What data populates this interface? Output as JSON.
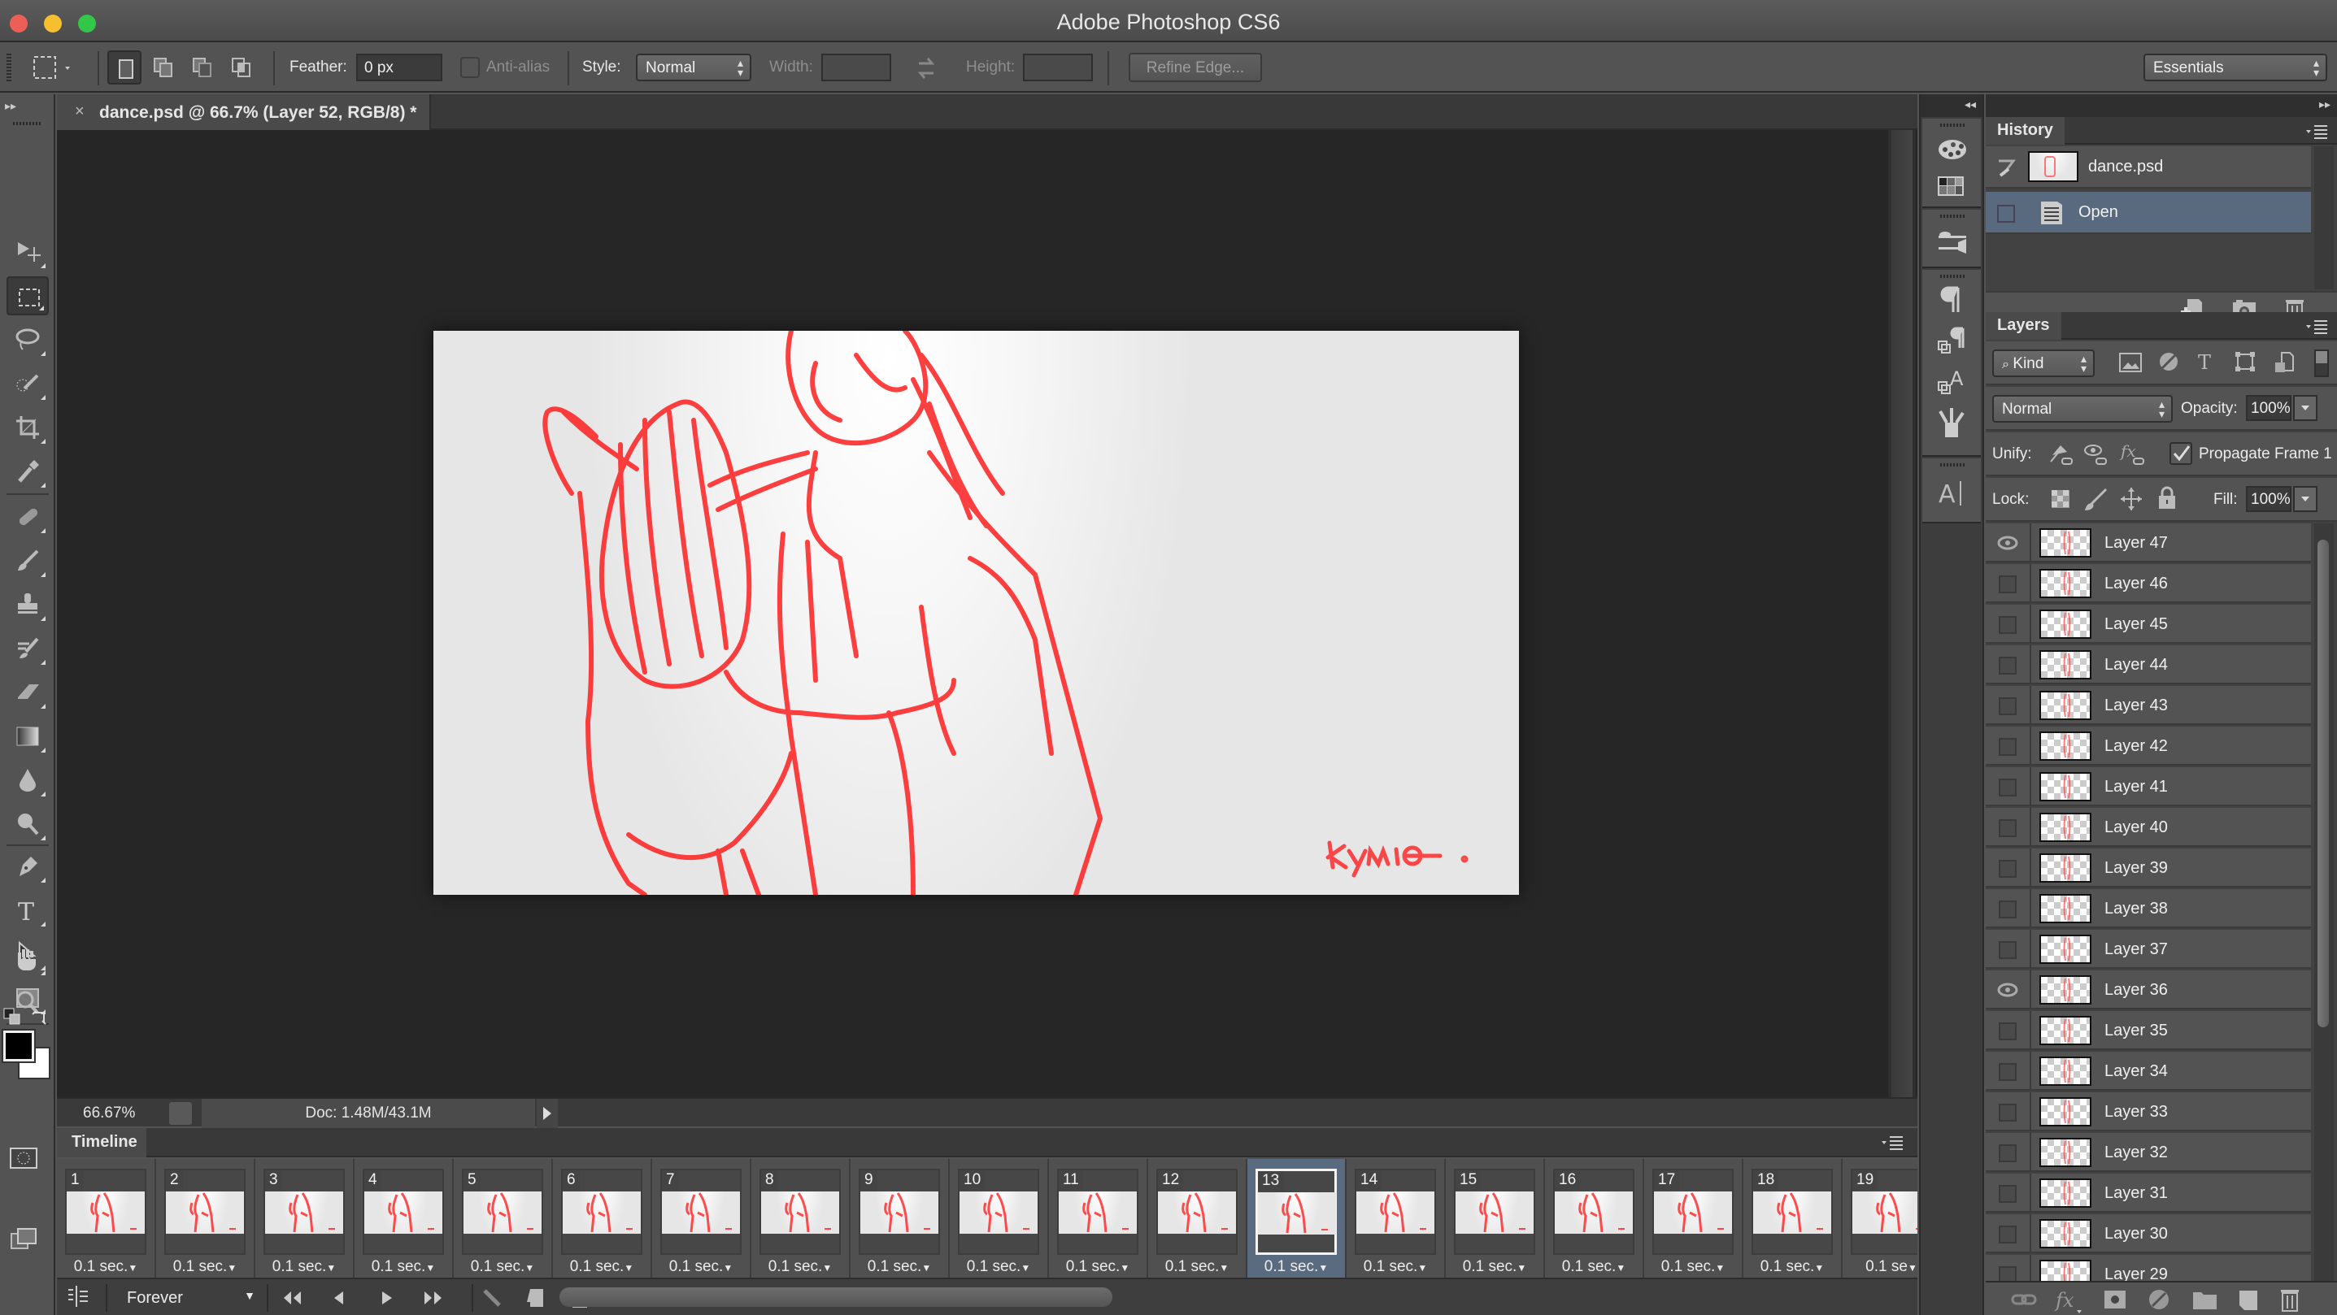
{
  "window": {
    "title": "Adobe Photoshop CS6",
    "traffic_colors": {
      "close": "#ec5f57",
      "minimize": "#f5bf2f",
      "zoom": "#32c748"
    }
  },
  "options_bar": {
    "feather_label": "Feather:",
    "feather_value": "0 px",
    "antialias_label": "Anti-alias",
    "style_label": "Style:",
    "style_value": "Normal",
    "width_label": "Width:",
    "width_value": "",
    "height_label": "Height:",
    "height_value": "",
    "refine_edge_label": "Refine Edge...",
    "workspace_value": "Essentials"
  },
  "tools": [
    {
      "name": "move-tool",
      "icon": "move-icon"
    },
    {
      "name": "rectangular-marquee-tool",
      "icon": "marquee-icon",
      "active": true
    },
    {
      "name": "lasso-tool",
      "icon": "lasso-icon"
    },
    {
      "name": "quick-selection-tool",
      "icon": "quick-selection-icon"
    },
    {
      "name": "crop-tool",
      "icon": "crop-icon"
    },
    {
      "name": "eyedropper-tool",
      "icon": "eyedropper-icon"
    },
    {
      "name": "spot-healing-tool",
      "icon": "bandage-icon"
    },
    {
      "name": "brush-tool",
      "icon": "brush-icon"
    },
    {
      "name": "clone-stamp-tool",
      "icon": "stamp-icon"
    },
    {
      "name": "history-brush-tool",
      "icon": "history-brush-icon"
    },
    {
      "name": "eraser-tool",
      "icon": "eraser-icon"
    },
    {
      "name": "gradient-tool",
      "icon": "gradient-icon"
    },
    {
      "name": "blur-tool",
      "icon": "drop-icon"
    },
    {
      "name": "dodge-tool",
      "icon": "dodge-icon"
    },
    {
      "name": "pen-tool",
      "icon": "pen-icon"
    },
    {
      "name": "type-tool",
      "icon": "type-icon"
    },
    {
      "name": "path-selection-tool",
      "icon": "arrow-icon"
    },
    {
      "name": "rectangle-tool",
      "icon": "rectangle-icon"
    },
    {
      "name": "hand-tool",
      "icon": "hand-icon"
    },
    {
      "name": "zoom-tool",
      "icon": "magnifier-icon"
    }
  ],
  "colors": {
    "foreground": "#000000",
    "background": "#ffffff"
  },
  "document": {
    "tab_title": "dance.psd @ 66.7% (Layer 52, RGB/8) *",
    "signature": "kymio .",
    "stroke_color": "#ff1a1a"
  },
  "status": {
    "zoom": "66.67%",
    "doc_size": "Doc: 1.48M/43.1M"
  },
  "timeline": {
    "title": "Timeline",
    "loop": "Forever",
    "selected_frame": 13,
    "frames": [
      {
        "n": "1",
        "d": "0.1 sec."
      },
      {
        "n": "2",
        "d": "0.1 sec."
      },
      {
        "n": "3",
        "d": "0.1 sec."
      },
      {
        "n": "4",
        "d": "0.1 sec."
      },
      {
        "n": "5",
        "d": "0.1 sec."
      },
      {
        "n": "6",
        "d": "0.1 sec."
      },
      {
        "n": "7",
        "d": "0.1 sec."
      },
      {
        "n": "8",
        "d": "0.1 sec."
      },
      {
        "n": "9",
        "d": "0.1 sec."
      },
      {
        "n": "10",
        "d": "0.1 sec."
      },
      {
        "n": "11",
        "d": "0.1 sec."
      },
      {
        "n": "12",
        "d": "0.1 sec."
      },
      {
        "n": "13",
        "d": "0.1 sec."
      },
      {
        "n": "14",
        "d": "0.1 sec."
      },
      {
        "n": "15",
        "d": "0.1 sec."
      },
      {
        "n": "16",
        "d": "0.1 sec."
      },
      {
        "n": "17",
        "d": "0.1 sec."
      },
      {
        "n": "18",
        "d": "0.1 sec."
      },
      {
        "n": "19",
        "d": "0.1 se"
      }
    ]
  },
  "history": {
    "title": "History",
    "snapshot": "dance.psd",
    "items": [
      "Open"
    ]
  },
  "layers": {
    "title": "Layers",
    "filter_kind": "Kind",
    "blend_mode": "Normal",
    "opacity_label": "Opacity:",
    "opacity": "100%",
    "unify_label": "Unify:",
    "propagate_label": "Propagate Frame 1",
    "propagate_checked": true,
    "lock_label": "Lock:",
    "fill_label": "Fill:",
    "fill": "100%",
    "items": [
      {
        "name": "Layer 47",
        "visible": true
      },
      {
        "name": "Layer 46",
        "visible": false
      },
      {
        "name": "Layer 45",
        "visible": false
      },
      {
        "name": "Layer 44",
        "visible": false
      },
      {
        "name": "Layer 43",
        "visible": false
      },
      {
        "name": "Layer 42",
        "visible": false
      },
      {
        "name": "Layer 41",
        "visible": false
      },
      {
        "name": "Layer 40",
        "visible": false
      },
      {
        "name": "Layer 39",
        "visible": false
      },
      {
        "name": "Layer 38",
        "visible": false
      },
      {
        "name": "Layer 37",
        "visible": false
      },
      {
        "name": "Layer 36",
        "visible": true
      },
      {
        "name": "Layer 35",
        "visible": false
      },
      {
        "name": "Layer 34",
        "visible": false
      },
      {
        "name": "Layer 33",
        "visible": false
      },
      {
        "name": "Layer 32",
        "visible": false
      },
      {
        "name": "Layer 31",
        "visible": false
      },
      {
        "name": "Layer 30",
        "visible": false
      },
      {
        "name": "Layer 29",
        "visible": false
      }
    ]
  }
}
